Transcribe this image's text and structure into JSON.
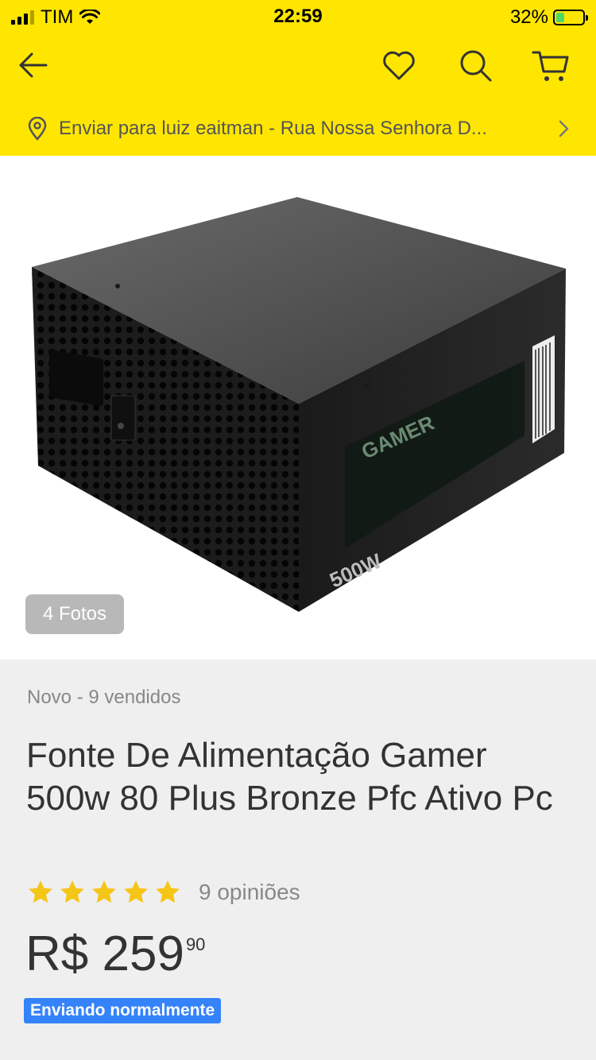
{
  "status_bar": {
    "carrier": "TIM",
    "time": "22:59",
    "battery_percent": "32%",
    "battery_level": 0.32
  },
  "nav": {
    "icons": [
      "back-arrow-icon",
      "heart-icon",
      "search-icon",
      "cart-icon"
    ]
  },
  "shipping": {
    "text": "Enviar para luiz eaitman - Rua Nossa Senhora D..."
  },
  "gallery": {
    "photos_label": "4 Fotos",
    "product_image_text": {
      "brand": "GAMER",
      "wattage": "500W"
    }
  },
  "product": {
    "condition": "Novo - 9 vendidos",
    "title": "Fonte De Alimentação Gamer 500w 80 Plus Bronze Pfc Ativo Pc",
    "rating_stars": 5,
    "reviews": "9 opiniões",
    "price_main": "R$ 259",
    "price_cents": "90",
    "shipping_badge": "Enviando normalmente"
  },
  "colors": {
    "brand_yellow": "#ffe600",
    "accent_blue": "#3483fa",
    "star_yellow": "#f5c518",
    "battery_green": "#4cd964"
  }
}
